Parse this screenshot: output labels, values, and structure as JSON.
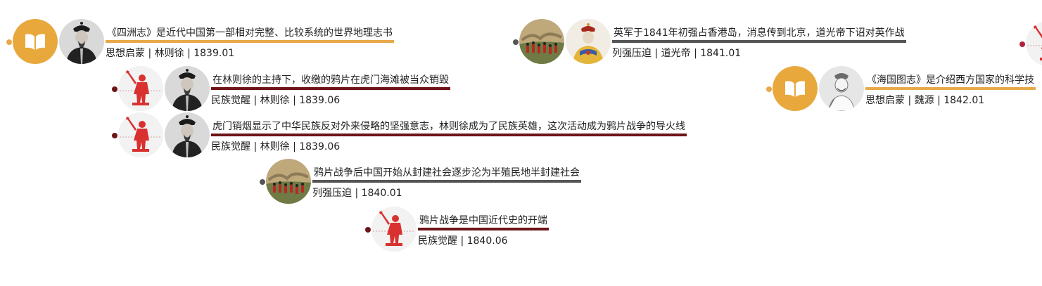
{
  "colors": {
    "thought": "#e8a94a",
    "awakening": "#6e1418",
    "oppression": "#555555"
  },
  "events": [
    {
      "title": "《四洲志》是近代中国第一部相对完整、比较系统的世界地理志书",
      "meta": "思想启蒙 | 林则徐 | 1839.01",
      "category_icon": "book-icon",
      "person_icon": "lin-zexu-portrait"
    },
    {
      "title": "在林则徐的主持下，收缴的鸦片在虎门海滩被当众销毁",
      "meta": "民族觉醒 | 林则徐 | 1839.06",
      "category_icon": "bugler-icon",
      "person_icon": "lin-zexu-portrait"
    },
    {
      "title": "虎门销烟显示了中华民族反对外来侵略的坚强意志，林则徐成为了民族英雄，这次活动成为鸦片战争的导火线",
      "meta": "民族觉醒 | 林则徐 | 1839.06",
      "category_icon": "bugler-icon",
      "person_icon": "lin-zexu-portrait"
    },
    {
      "title": "鸦片战争后中国开始从封建社会逐步沦为半殖民地半封建社会",
      "meta": "列强压迫 | 1840.01",
      "category_icon": "battle-painting"
    },
    {
      "title": "鸦片战争是中国近代史的开端",
      "meta": "民族觉醒 | 1840.06",
      "category_icon": "bugler-icon"
    },
    {
      "title": "英军于1841年初强占香港岛，消息传到北京，道光帝下诏对英作战",
      "meta": "列强压迫 | 道光帝 | 1841.01",
      "category_icon": "battle-painting",
      "person_icon": "daoguang-emperor-portrait"
    },
    {
      "title": "《海国图志》是介绍西方国家的科学技",
      "meta": "思想启蒙 | 魏源 | 1842.01",
      "category_icon": "book-icon",
      "person_icon": "wei-yuan-portrait"
    }
  ]
}
